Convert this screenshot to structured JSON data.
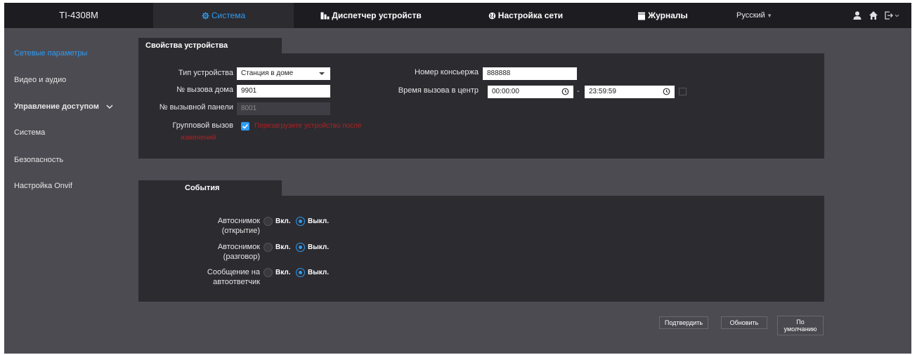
{
  "app": {
    "model": "TI-4308M"
  },
  "topnav": {
    "items": [
      {
        "label": "Система",
        "icon": "gear-icon"
      },
      {
        "label": "Диспетчер устройств",
        "icon": "devices-icon"
      },
      {
        "label": "Настройка сети",
        "icon": "globe-icon"
      },
      {
        "label": "Журналы",
        "icon": "log-icon"
      }
    ],
    "language": "Русский",
    "icons": [
      "user-icon",
      "home-icon",
      "logout-icon"
    ],
    "accent_color": "#2e9cf3"
  },
  "sidebar": {
    "items": [
      {
        "label": "Сетевые параметры"
      },
      {
        "label": "Видео и аудио"
      },
      {
        "label": "Управление доступом"
      },
      {
        "label": "Система"
      },
      {
        "label": "Безопасность"
      },
      {
        "label": "Настройка Onvif"
      }
    ]
  },
  "device_props": {
    "tab_title": "Свойства устройства",
    "device_type_label": "Тип устройства",
    "device_type_value": "Станция в доме",
    "house_call_label": "№ вызова дома",
    "house_call_value": "9901",
    "panel_call_label": "№ вызывной панели",
    "panel_call_value": "8001",
    "group_call_label": "Групповой вызов",
    "group_call_checked": true,
    "warning_line1": "Перезагрузите устройство после",
    "warning_line2": "изменений",
    "concierge_label": "Номер консьержа",
    "concierge_value": "888888",
    "call_time_label": "Время вызова в центр",
    "call_time_from": "00:00:00",
    "call_time_sep": "-",
    "call_time_to": "23:59:59",
    "warning_color": "#b52020"
  },
  "events": {
    "tab_title": "События",
    "rows": [
      {
        "label_line1": "Автоснимок",
        "label_line2": "(открытие)",
        "on_label": "Вкл.",
        "off_label": "Выкл.",
        "selected": "off"
      },
      {
        "label_line1": "Автоснимок",
        "label_line2": "(разговор)",
        "on_label": "Вкл.",
        "off_label": "Выкл.",
        "selected": "off"
      },
      {
        "label_line1": "Сообщение на",
        "label_line2": "автоответчик",
        "on_label": "Вкл.",
        "off_label": "Выкл.",
        "selected": "off"
      }
    ]
  },
  "actions": {
    "confirm": "Подтвердить",
    "refresh": "Обновить",
    "default_line1": "По",
    "default_line2": "умолчанию"
  }
}
